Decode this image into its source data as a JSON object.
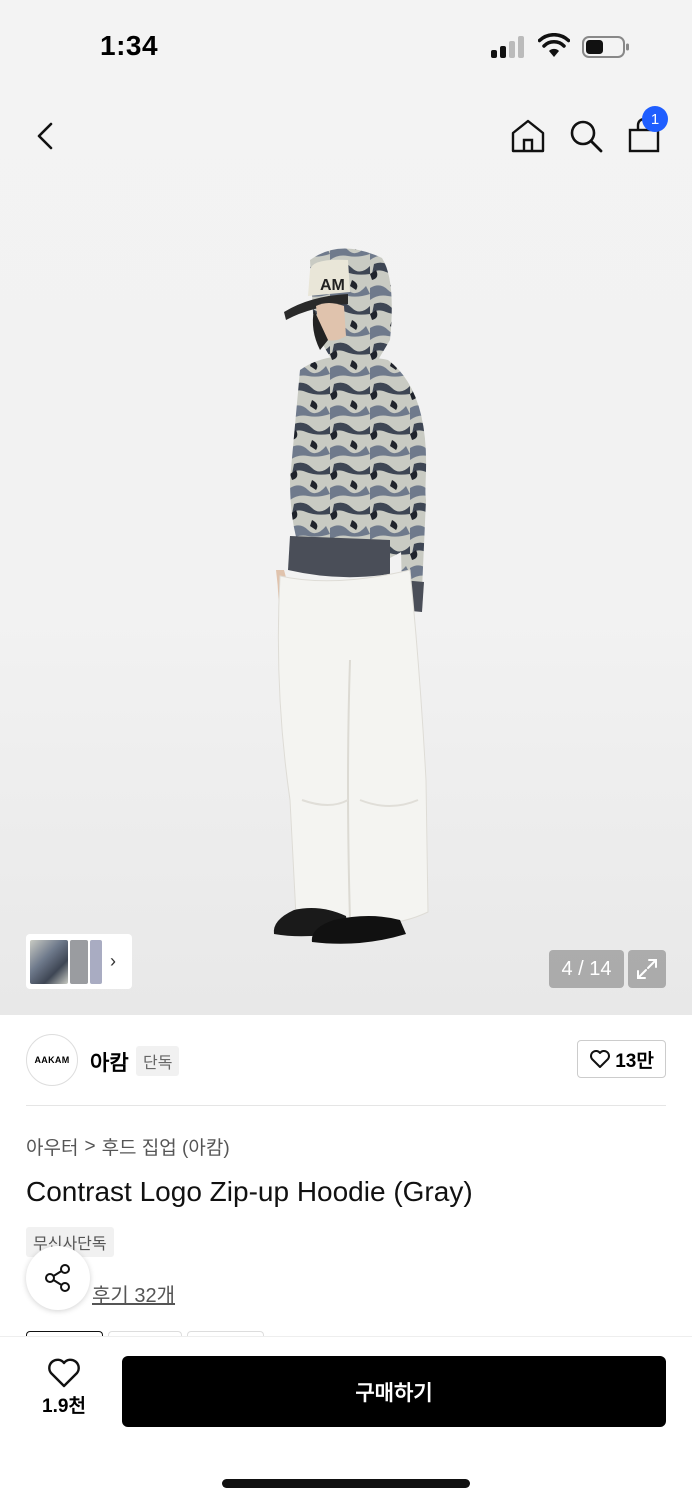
{
  "status_bar": {
    "time": "1:34"
  },
  "nav": {
    "icons": [
      "back-icon",
      "home-icon",
      "search-icon",
      "shopping-bag-icon"
    ],
    "cart_count": "1"
  },
  "gallery": {
    "counter": "4 / 14",
    "thumb_colors": [
      "#7f8690",
      "#9a9ca0",
      "#a9acc2"
    ],
    "chevron": "›",
    "logo_text": "AM"
  },
  "brand": {
    "logo_text": "AAKAM",
    "name": "아캄",
    "tag": "단독",
    "like_count": "13만"
  },
  "product": {
    "breadcrumb": [
      "아우터",
      "후드 집업 (아캄)"
    ],
    "breadcrumb_sep": ">",
    "title": "Contrast Logo Zip-up Hoodie (Gray)",
    "badge": "무신사단독",
    "review_link": "후기 32개"
  },
  "bottom_bar": {
    "wishlist_count": "1.9천",
    "buy_label": "구매하기"
  },
  "colors": {
    "accent": "#1f5eff",
    "buy_button": "#000000"
  }
}
